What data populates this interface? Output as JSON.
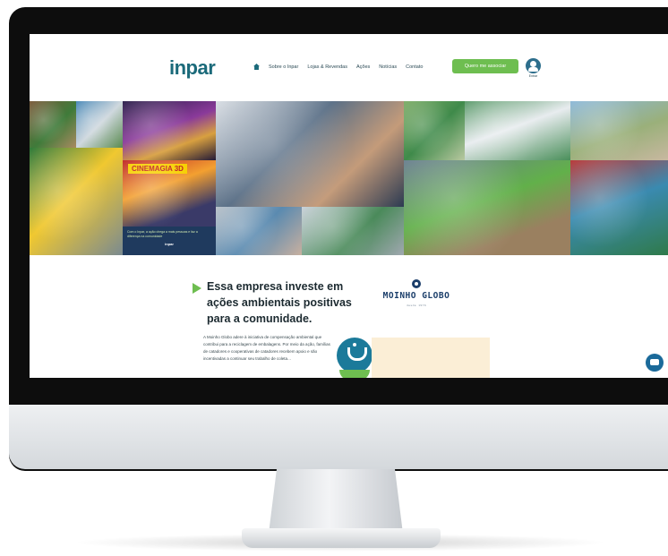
{
  "header": {
    "logo_text": "inpar",
    "nav": [
      "Sobre o Inpar",
      "Lojas & Revendas",
      "Ações",
      "Notícias",
      "Contato"
    ],
    "cta_label": "Quero me associar",
    "user_label": "Entrar"
  },
  "collage": {
    "cinema_label": "CINEMAGIA 3D",
    "caption": "Com o Inpar, a ação chega a mais pessoas e faz a diferença na comunidade",
    "caption_logo": "inpar"
  },
  "content": {
    "headline": "Essa empresa investe em ações ambientais positivas para a comunidade.",
    "body": "A Moinho Globo adere à iniciativa de compensação ambiental que contribui para a reciclagem de embalagens. Por meio da ação, famílias de catadores e cooperativas de catadores recebem apoio e são incentivadas a continuar seu trabalho de coleta...",
    "partner_name": "MOINHO GLOBO",
    "partner_sub": "desde 1976"
  },
  "colors": {
    "brand_teal": "#1b6a7a",
    "accent_green": "#6ebe50",
    "monitor_bezel": "#0d0d0d"
  },
  "icons": [
    "home-icon",
    "user-icon",
    "play-icon",
    "badge-icon",
    "moinho-icon",
    "chat-icon"
  ]
}
